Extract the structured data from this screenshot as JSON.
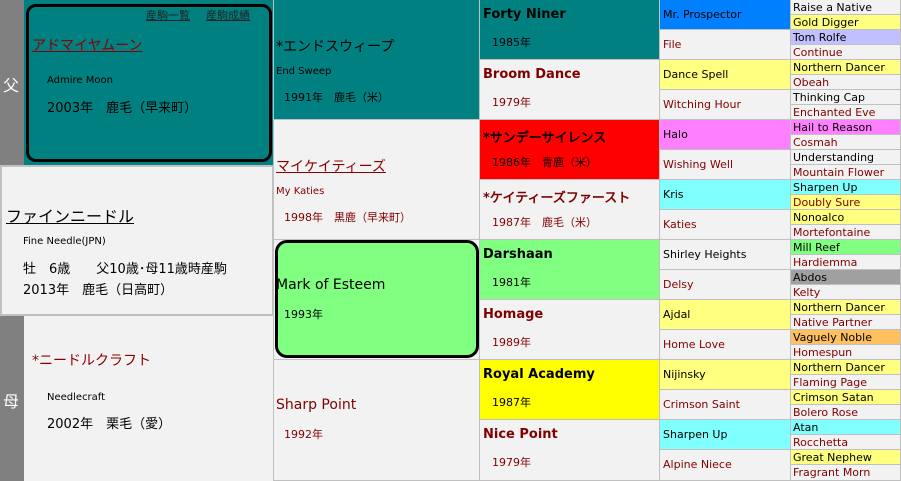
{
  "side_labels": {
    "sire": "父",
    "dam": "母"
  },
  "links": {
    "list": "産駒一覧",
    "stats": "産駒成績"
  },
  "horse": {
    "name": "ファインニードル",
    "en": "Fine Needle(JPN)",
    "info": "牡　6歳　　父10歳･母11歳時産駒",
    "birth": "2013年　鹿毛（日高町）"
  },
  "sire": {
    "name": "アドマイヤムーン",
    "en": "Admire Moon",
    "info": "2003年　鹿毛（早来町）"
  },
  "dam": {
    "name": "*ニードルクラフト",
    "en": "Needlecraft",
    "info": "2002年　栗毛（愛）"
  },
  "g2": [
    {
      "name": "*エンドスウィープ",
      "en": "End Sweep",
      "info": "1991年　鹿毛（米）"
    },
    {
      "name": "マイケイティーズ",
      "en": "My Katies",
      "info": "1998年　黒鹿（早来町）"
    },
    {
      "name": "Mark of Esteem",
      "info": "1993年"
    },
    {
      "name": "Sharp Point",
      "info": "1992年"
    }
  ],
  "g3": [
    {
      "name": "Forty Niner",
      "year": "1985年"
    },
    {
      "name": "Broom Dance",
      "year": "1979年"
    },
    {
      "name": "*サンデーサイレンス",
      "year": "1986年　青鹿（米）"
    },
    {
      "name": "*ケイティーズファースト",
      "year": "1987年　鹿毛（米）"
    },
    {
      "name": "Darshaan",
      "year": "1981年"
    },
    {
      "name": "Homage",
      "year": "1989年"
    },
    {
      "name": "Royal Academy",
      "year": "1987年"
    },
    {
      "name": "Nice Point",
      "year": "1979年"
    }
  ],
  "g4": [
    "Mr. Prospector",
    "File",
    "Dance Spell",
    "Witching Hour",
    "Halo",
    "Wishing Well",
    "Kris",
    "Katies",
    "Shirley Heights",
    "Delsy",
    "Ajdal",
    "Home Love",
    "Nijinsky",
    "Crimson Saint",
    "Sharpen Up",
    "Alpine Niece"
  ],
  "g5": [
    "Raise a Native",
    "Gold Digger",
    "Tom Rolfe",
    "Continue",
    "Northern Dancer",
    "Obeah",
    "Thinking Cap",
    "Enchanted Eve",
    "Hail to Reason",
    "Cosmah",
    "Understanding",
    "Mountain Flower",
    "Sharpen Up",
    "Doubly Sure",
    "Nonoalco",
    "Mortefontaine",
    "Mill Reef",
    "Hardiemma",
    "Abdos",
    "Kelty",
    "Northern Dancer",
    "Native Partner",
    "Vaguely Noble",
    "Homespun",
    "Northern Dancer",
    "Flaming Page",
    "Crimson Satan",
    "Bolero Rose",
    "Atan",
    "Rocchetta",
    "Great Nephew",
    "Fragrant Morn"
  ],
  "colors": {
    "teal": "#008080",
    "green": "#80ff80",
    "red": "#ff0000",
    "yellow": "#ffff00",
    "name_red": "#8b0000",
    "side_gray": "#808080"
  }
}
